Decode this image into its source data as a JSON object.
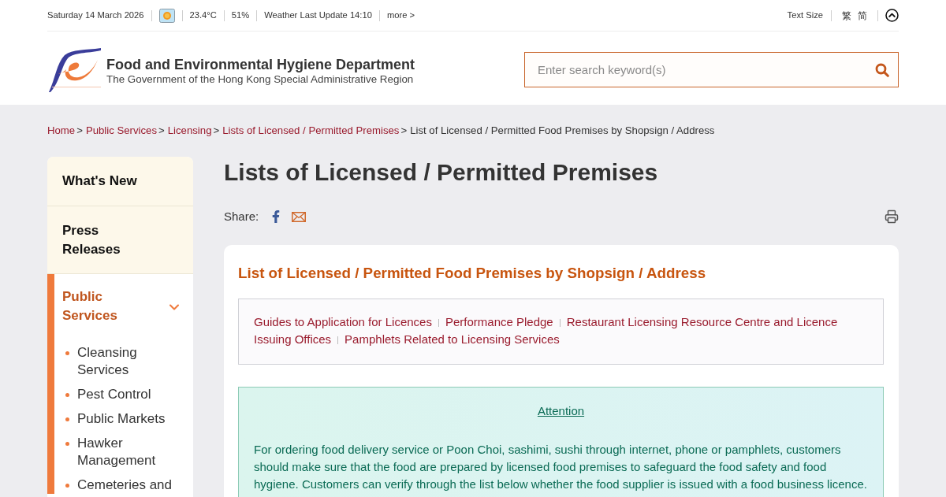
{
  "top_bar": {
    "date": "Saturday 14 March 2026",
    "temperature": "23.4°C",
    "humidity": "51%",
    "weather_update": "Weather Last Update 14:10",
    "more_link": "more >",
    "text_size": "Text Size",
    "languages": [
      "繁",
      "简"
    ]
  },
  "header": {
    "department_name": "Food and Environmental Hygiene Department",
    "government_name": "The Government of the Hong Kong Special Administrative Region",
    "search": {
      "placeholder": "Enter search keyword(s)"
    }
  },
  "breadcrumb": [
    {
      "label": "Home",
      "current": false,
      "separator": ">"
    },
    {
      "label": "Public Services",
      "current": false,
      "separator": ">"
    },
    {
      "label": "Licensing",
      "current": false,
      "separator": ">"
    },
    {
      "label": "Lists of Licensed / Permitted Premises",
      "current": false,
      "separator": ">"
    },
    {
      "label": "List of Licensed / Permitted Food Premises by Shopsign / Address",
      "current": true
    }
  ],
  "sidebar": {
    "items": [
      {
        "label": "What's New",
        "selected": false,
        "expanded": false
      },
      {
        "label": "Press Releases",
        "selected": false,
        "expanded": false
      },
      {
        "label": "Public Services",
        "selected": true,
        "expanded": true,
        "children": [
          {
            "label": "Cleansing Services"
          },
          {
            "label": "Pest Control"
          },
          {
            "label": "Public Markets"
          },
          {
            "label": "Hawker Management"
          },
          {
            "label": "Cemeteries and"
          }
        ]
      }
    ]
  },
  "page_title": "Lists of Licensed / Permitted Premises",
  "share": {
    "label": "Share:"
  },
  "content": {
    "title": "List of Licensed / Permitted Food Premises by Shopsign / Address",
    "links": [
      "Guides to Application for Licences",
      "Performance Pledge",
      "Restaurant Licensing Resource Centre and Licence Issuing Offices",
      "Pamphlets Related to Licensing Services"
    ],
    "attention": {
      "heading": "Attention",
      "text": "For ordering food delivery service or Poon Choi, sashimi, sushi through internet, phone or pamphlets, customers should make sure that the food are prepared by licensed food premises to safeguard the food safety and food hygiene. Customers can verify through the list below whether the food supplier is issued with a food business licence."
    }
  }
}
